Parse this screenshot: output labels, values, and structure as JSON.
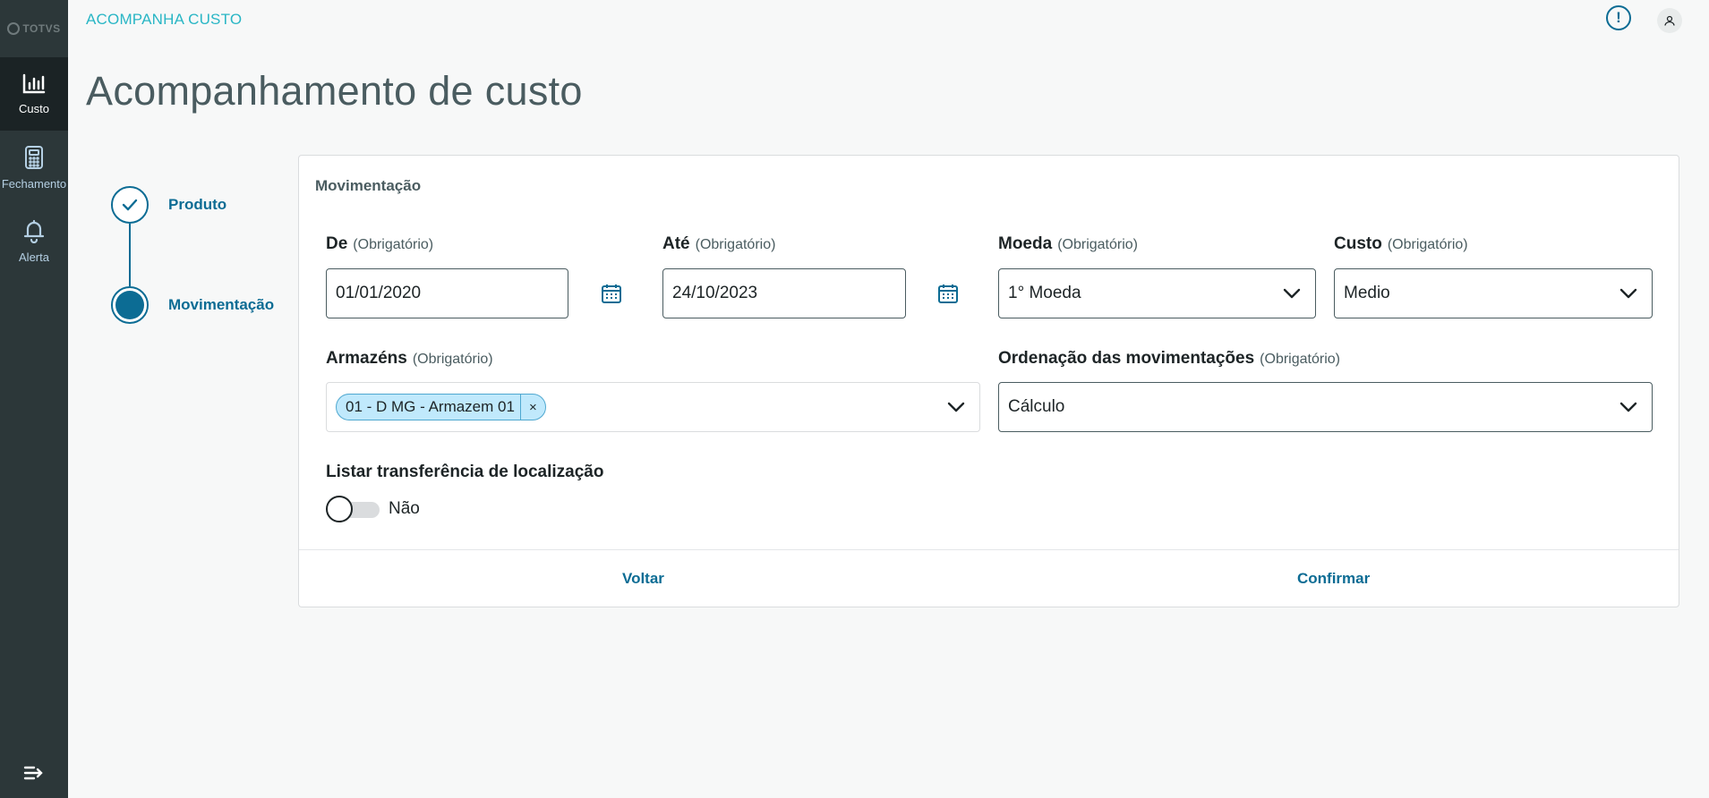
{
  "brand": {
    "name": "TOTVS"
  },
  "sidebar": {
    "items": [
      {
        "label": "Custo",
        "icon": "bar-chart-icon",
        "active": true
      },
      {
        "label": "Fechamento",
        "icon": "calculator-icon",
        "active": false
      },
      {
        "label": "Alerta",
        "icon": "bell-icon",
        "active": false
      }
    ]
  },
  "header": {
    "app_title": "ACOMPANHA CUSTO",
    "help_glyph": "!"
  },
  "page": {
    "title": "Acompanhamento de custo"
  },
  "stepper": {
    "steps": [
      {
        "label": "Produto",
        "state": "done"
      },
      {
        "label": "Movimentação",
        "state": "current"
      }
    ]
  },
  "form": {
    "section_title": "Movimentação",
    "required_text": "(Obrigatório)",
    "de": {
      "label": "De",
      "value": "01/01/2020"
    },
    "ate": {
      "label": "Até",
      "value": "24/10/2023"
    },
    "moeda": {
      "label": "Moeda",
      "value": "1° Moeda"
    },
    "custo": {
      "label": "Custo",
      "value": "Medio"
    },
    "armazens": {
      "label": "Armazéns",
      "tags": [
        "01 - D MG - Armazem 01"
      ],
      "tag_close": "×"
    },
    "ordenacao": {
      "label": "Ordenação das movimentações",
      "value": "Cálculo"
    },
    "listar": {
      "label": "Listar transferência de localização",
      "value": "Não",
      "on": false
    }
  },
  "footer": {
    "back_label": "Voltar",
    "confirm_label": "Confirmar"
  },
  "colors": {
    "primary": "#0c6c94",
    "accent": "#29b6c5",
    "sidebar": "#2c3739"
  }
}
